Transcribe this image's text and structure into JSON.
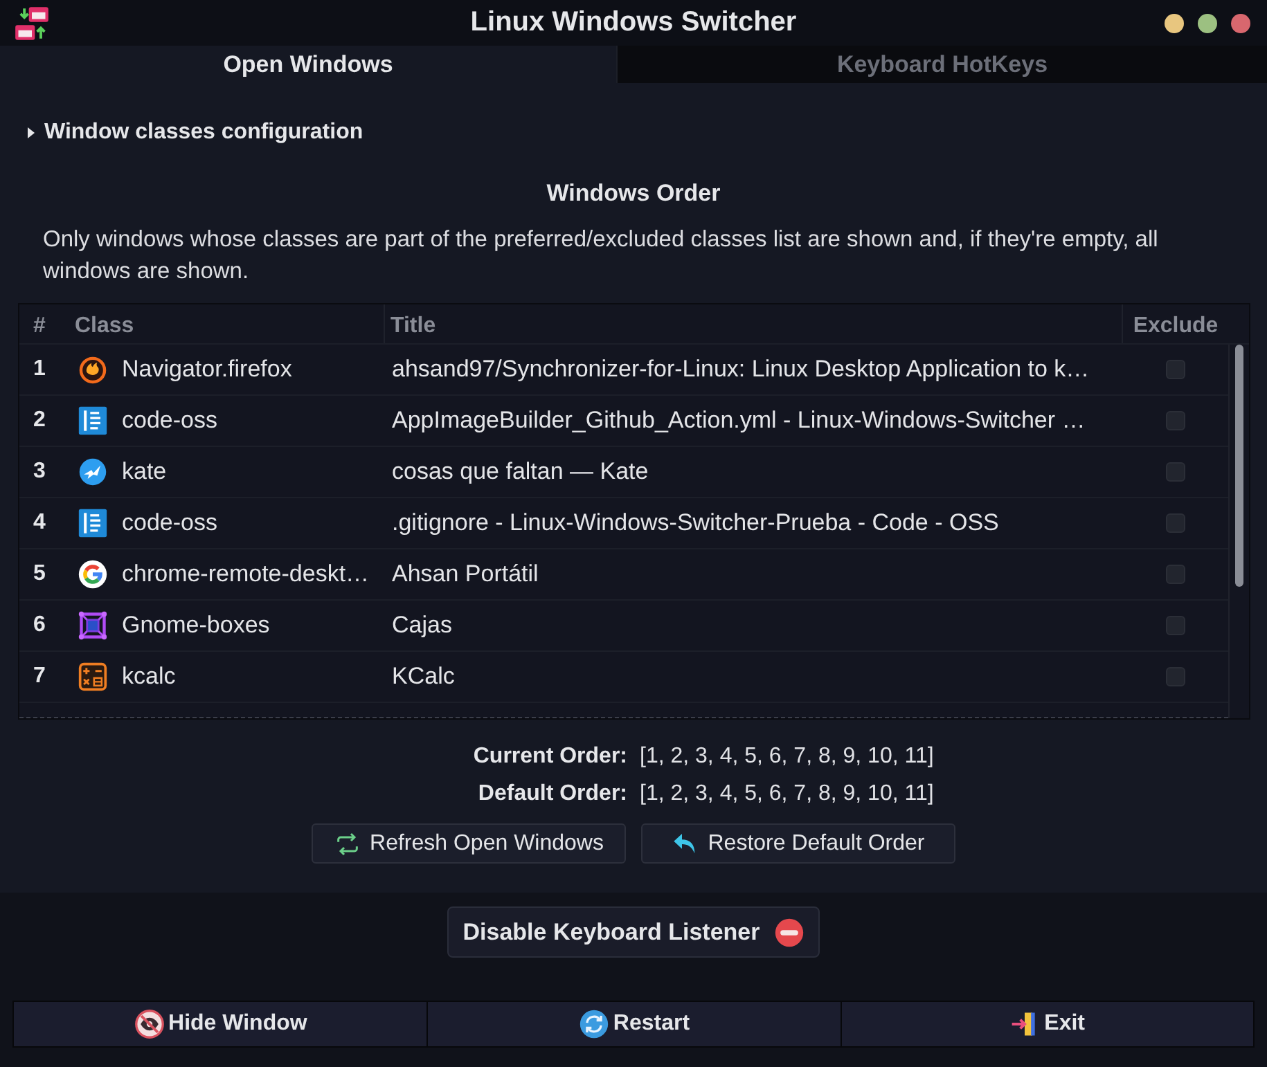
{
  "window": {
    "title": "Linux Windows Switcher",
    "controls": [
      {
        "color": "#e8c67f"
      },
      {
        "color": "#9cc081"
      },
      {
        "color": "#d8676e"
      }
    ]
  },
  "tabs": [
    {
      "label": "Open Windows",
      "selected": true
    },
    {
      "label": "Keyboard HotKeys",
      "selected": false
    }
  ],
  "expander": {
    "label": "Window classes configuration",
    "expanded": false
  },
  "windows_order": {
    "heading": "Windows Order",
    "description": "Only windows whose classes are part of the preferred/excluded classes list are shown and, if they're empty, all windows are shown.",
    "table": {
      "columns": [
        "#",
        "Class",
        "Title",
        "Exclude"
      ],
      "rows": [
        {
          "number": "1",
          "class": "Navigator.firefox",
          "title": "ahsand97/Synchronizer-for-Linux: Linux Desktop Application to k…",
          "excluded": false
        },
        {
          "number": "2",
          "class": "code-oss",
          "title": "AppImageBuilder_Github_Action.yml - Linux-Windows-Switcher …",
          "excluded": false
        },
        {
          "number": "3",
          "class": "kate",
          "title": "cosas que faltan — Kate",
          "excluded": false
        },
        {
          "number": "4",
          "class": "code-oss",
          "title": ".gitignore - Linux-Windows-Switcher-Prueba - Code - OSS",
          "excluded": false
        },
        {
          "number": "5",
          "class": "chrome-remote-deskt…",
          "title": "Ahsan Portátil",
          "excluded": false
        },
        {
          "number": "6",
          "class": "Gnome-boxes",
          "title": "Cajas",
          "excluded": false
        },
        {
          "number": "7",
          "class": "kcalc",
          "title": "KCalc",
          "excluded": false
        }
      ]
    },
    "orders": [
      {
        "label": "Current Order:",
        "value": "[1, 2, 3, 4, 5, 6, 7, 8, 9, 10, 11]"
      },
      {
        "label": "Default Order:",
        "value": "[1, 2, 3, 4, 5, 6, 7, 8, 9, 10, 11]"
      }
    ],
    "buttons": [
      {
        "label": "Refresh Open Windows"
      },
      {
        "label": "Restore Default Order"
      }
    ]
  },
  "listener_button": {
    "label": "Disable Keyboard Listener"
  },
  "footer_buttons": [
    {
      "label": "Hide Window"
    },
    {
      "label": "Restart"
    },
    {
      "label": "Exit"
    }
  ]
}
